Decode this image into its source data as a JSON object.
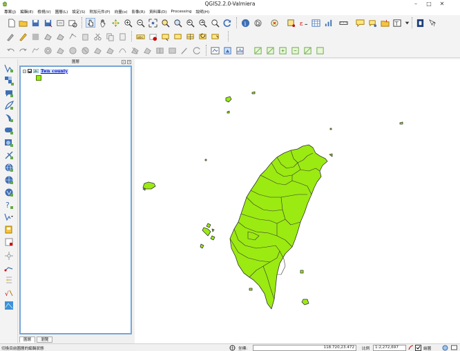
{
  "window": {
    "title": "QGIS2.2.0-Valmiera"
  },
  "menu": [
    "專案(J)",
    "編輯(E)",
    "檢視(V)",
    "圖層(L)",
    "設定(S)",
    "附加元件(P)",
    "向量(o)",
    "影像(R)",
    "資料庫(D)",
    "Processing",
    "說明(H)"
  ],
  "layers_panel": {
    "title": "圖層",
    "layer": {
      "name": "Twn_county",
      "visible": true,
      "fill_color": "#9bea12"
    },
    "tabs": [
      "圖層",
      "瀏覽"
    ]
  },
  "map": {
    "fill_color": "#9bea12",
    "stroke_color": "#333333"
  },
  "status": {
    "message": "切換目前圖層的編輯狀態",
    "coordinate_label": "坐標:",
    "coordinate": "118.720,23.472",
    "scale_label": "比例",
    "scale": "1:2,272,697",
    "render_label": "繪圖"
  },
  "icons": {
    "toolbar1": [
      "new-project-icon",
      "open-project-icon",
      "save-project-icon",
      "save-as-icon",
      "print-composer-icon",
      "composer-manager-icon",
      "touch-icon",
      "pan-icon",
      "pan-to-selection-icon",
      "zoom-in-icon",
      "zoom-out-icon",
      "zoom-full-icon",
      "zoom-to-selection-icon",
      "zoom-to-layer-icon",
      "zoom-last-icon",
      "zoom-next-icon",
      "refresh-icon",
      "identify-icon",
      "select-icon",
      "deselect-icon",
      "field-calculator-icon",
      "attribute-table-icon",
      "measure-icon",
      "annotation-icon",
      "tips-icon",
      "bookmark-icon",
      "new-bookmark-icon",
      "text-annotation-icon",
      "help-icon"
    ],
    "left": [
      "add-vector-layer-icon",
      "add-raster-layer-icon",
      "add-postgis-icon",
      "add-spatialite-icon",
      "add-mssql-icon",
      "add-oracle-icon",
      "add-wms-icon",
      "add-wcs-icon",
      "add-wfs-icon",
      "add-delimited-text-icon",
      "new-shapefile-icon",
      "new-spatialite-icon",
      "digitize-icon",
      "capture-point-icon",
      "gps-icon",
      "raster-calc-icon",
      "georeferencer-icon"
    ]
  }
}
